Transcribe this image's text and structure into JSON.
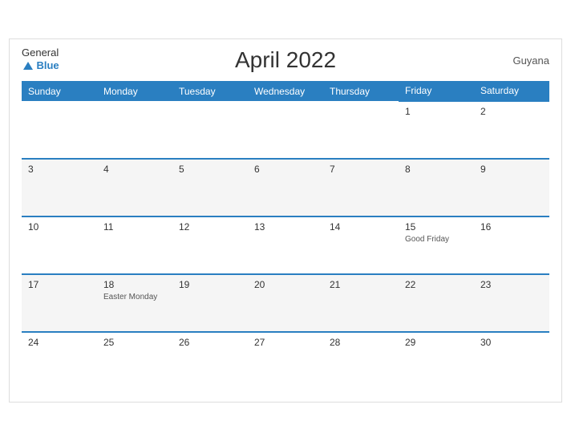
{
  "header": {
    "title": "April 2022",
    "country": "Guyana",
    "logo_general": "General",
    "logo_blue": "Blue"
  },
  "weekdays": [
    "Sunday",
    "Monday",
    "Tuesday",
    "Wednesday",
    "Thursday",
    "Friday",
    "Saturday"
  ],
  "weeks": [
    [
      {
        "day": "",
        "event": ""
      },
      {
        "day": "",
        "event": ""
      },
      {
        "day": "",
        "event": ""
      },
      {
        "day": "",
        "event": ""
      },
      {
        "day": "",
        "event": ""
      },
      {
        "day": "1",
        "event": ""
      },
      {
        "day": "2",
        "event": ""
      }
    ],
    [
      {
        "day": "3",
        "event": ""
      },
      {
        "day": "4",
        "event": ""
      },
      {
        "day": "5",
        "event": ""
      },
      {
        "day": "6",
        "event": ""
      },
      {
        "day": "7",
        "event": ""
      },
      {
        "day": "8",
        "event": ""
      },
      {
        "day": "9",
        "event": ""
      }
    ],
    [
      {
        "day": "10",
        "event": ""
      },
      {
        "day": "11",
        "event": ""
      },
      {
        "day": "12",
        "event": ""
      },
      {
        "day": "13",
        "event": ""
      },
      {
        "day": "14",
        "event": ""
      },
      {
        "day": "15",
        "event": "Good Friday"
      },
      {
        "day": "16",
        "event": ""
      }
    ],
    [
      {
        "day": "17",
        "event": ""
      },
      {
        "day": "18",
        "event": "Easter Monday"
      },
      {
        "day": "19",
        "event": ""
      },
      {
        "day": "20",
        "event": ""
      },
      {
        "day": "21",
        "event": ""
      },
      {
        "day": "22",
        "event": ""
      },
      {
        "day": "23",
        "event": ""
      }
    ],
    [
      {
        "day": "24",
        "event": ""
      },
      {
        "day": "25",
        "event": ""
      },
      {
        "day": "26",
        "event": ""
      },
      {
        "day": "27",
        "event": ""
      },
      {
        "day": "28",
        "event": ""
      },
      {
        "day": "29",
        "event": ""
      },
      {
        "day": "30",
        "event": ""
      }
    ]
  ]
}
